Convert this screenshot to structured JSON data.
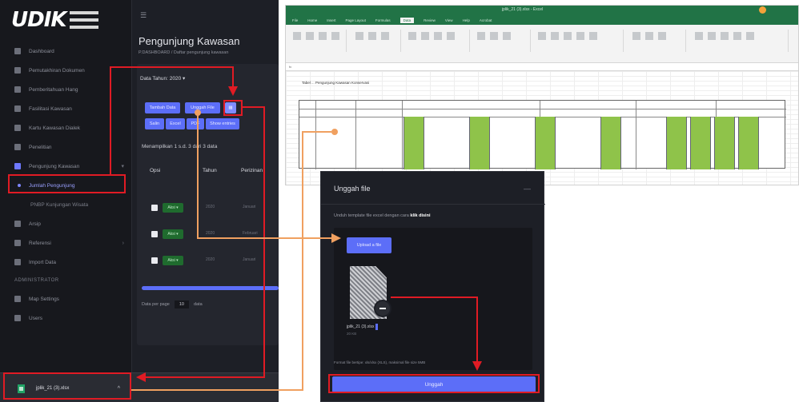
{
  "app": {
    "logo_text": "UDIK",
    "sidebar": {
      "items": [
        {
          "label": "Dashboard"
        },
        {
          "label": "Pemutakhiran Dokumen"
        },
        {
          "label": "Pemberitahuan Hang"
        },
        {
          "label": "Fasilitasi Kawasan"
        },
        {
          "label": "Kartu Kawasan Dialek"
        },
        {
          "label": "Penelitian"
        },
        {
          "label": "Pengunjung Kawasan"
        }
      ],
      "sub_items": [
        {
          "label": "Jumlah Pengunjung"
        },
        {
          "label": "PNBP Kunjungan Wisata"
        }
      ],
      "items2": [
        {
          "label": "Arsip"
        },
        {
          "label": "Referensi"
        },
        {
          "label": "Import Data"
        }
      ],
      "section_label": "ADMINISTRATOR",
      "admin_items": [
        {
          "label": "Map Settings"
        },
        {
          "label": "Users"
        }
      ]
    },
    "page_title": "Pengunjung Kawasan",
    "breadcrumb": "P.DASHBOARD  /  Daftar pengunjung kawasan",
    "year_filter": {
      "label": "Data Tahun",
      "value": "2020"
    },
    "buttons": {
      "tambah": "Tambah Data",
      "unggah": "Unggah File",
      "import_icon": "▦",
      "salin": "Salin",
      "excel": "Excel",
      "pdf": "PDF",
      "show": "Show entries"
    },
    "show_text": "Menampilkan 1 s.d. 3 dari 3 data",
    "table": {
      "headers": [
        "Opsi",
        "Tahun",
        "Perizinan"
      ],
      "rows": [
        {
          "aksi": "Aksi ▾",
          "tahun": "2020",
          "col": "Januari"
        },
        {
          "aksi": "Aksi ▾",
          "tahun": "2020",
          "col": "Februari"
        },
        {
          "aksi": "Aksi ▾",
          "tahun": "2020",
          "col": "Januari"
        }
      ]
    },
    "per_page": {
      "label": "Data per page",
      "value": "10",
      "suffix": "data"
    },
    "download": {
      "filename": "jplik_21 (3).xlsx"
    }
  },
  "excel": {
    "title": "jplik_21 (3).xlsx - Excel",
    "tabs": [
      "File",
      "Home",
      "Insert",
      "Page Layout",
      "Formulas",
      "Data",
      "Review",
      "View",
      "Help",
      "Acrobat"
    ],
    "active_tab": "Data",
    "table_title": "Tabel ... Pengunjung Kawasan Konservasi"
  },
  "modal": {
    "title": "Unggah file",
    "close": "—",
    "hint_prefix": "Unduh template file excel dengan cara",
    "hint_bold": "klik disini",
    "upload_button": "Upload a file",
    "file_name": "jplik_21 (3).xlsx",
    "file_size": "20 KB",
    "footer_note": "Format file bertipe: xls/xlsx (XLS), maksimal file size 5MB",
    "submit": "Unggah"
  },
  "colors": {
    "accent": "#5c6ef8",
    "annotation_red": "#e01b24",
    "annotation_orange": "#f0a060",
    "excel_green": "#217346",
    "cell_green": "#8fc34a"
  }
}
